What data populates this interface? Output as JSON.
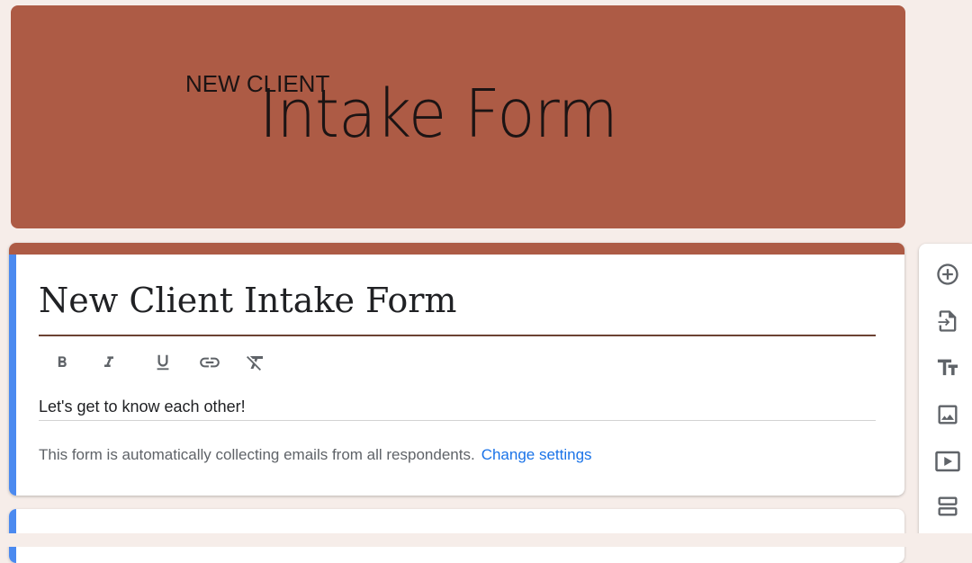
{
  "banner": {
    "line1": "NEW CLIENT",
    "line2": "Intake Form",
    "bg_color": "#ad5b45"
  },
  "form": {
    "title": "New Client Intake Form",
    "description": "Let's get to know each other!",
    "notice": "This form is automatically collecting emails from all respondents.",
    "notice_link": "Change settings",
    "accent_color": "#4b8af0"
  },
  "format_toolbar": {
    "buttons": [
      "bold-icon",
      "italic-icon",
      "underline-icon",
      "link-icon",
      "clear-format-icon"
    ]
  },
  "side_toolbar": {
    "tools": [
      "add-question-icon",
      "import-questions-icon",
      "add-title-icon",
      "add-image-icon",
      "add-video-icon",
      "add-section-icon"
    ]
  }
}
